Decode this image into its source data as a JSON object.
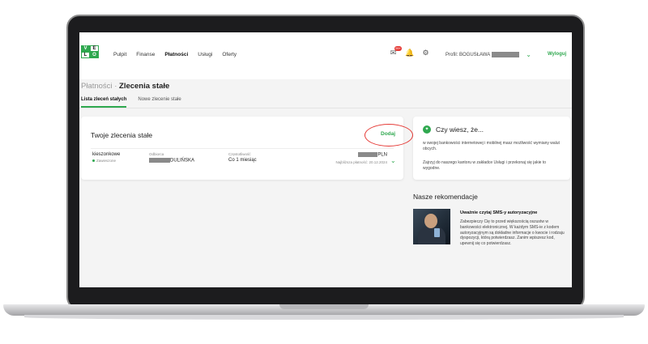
{
  "nav": {
    "items": [
      "Pulpit",
      "Finanse",
      "Płatności",
      "Usługi",
      "Oferty"
    ],
    "active": "Płatności"
  },
  "notifications": {
    "badge": "99+"
  },
  "profile": {
    "label": "Profil: BOGUSŁAWA"
  },
  "logout": "Wyloguj",
  "breadcrumb": {
    "parent": "Płatności",
    "separator": "·",
    "current": "Zlecenia stałe"
  },
  "tabs": [
    "Lista zleceń stałych",
    "Nowe zlecenie stałe"
  ],
  "orders": {
    "title": "Twoje zlecenia stałe",
    "add_label": "Dodaj",
    "row": {
      "name": "kieszonkowe",
      "status": "Zawieszone",
      "recipient_label": "Odbiorca",
      "recipient": "DULIŃSKA",
      "frequency_label": "Częstotliwość",
      "frequency": "Co 1 miesiąc",
      "amount": "PLN",
      "next_payment": "Najbliższa płatność: 20.12.2024"
    }
  },
  "tip": {
    "title": "Czy wiesz, że...",
    "p1": "w swojej bankowości internetowej i mobilnej masz możliwość wymiany walut obcych.",
    "p2": "Zajrzyj do naszego kantoru w zakładce Usługi i przekonaj się jakie to wygodne."
  },
  "recommendations": {
    "title": "Nasze rekomendacje",
    "item_title": "Uważnie czytaj SMS-y autoryzacyjne",
    "item_text": "Zabezpieczy Cię to przed większością oszustw w bankowości elektronicznej. W każdym SMS-ie z kodem autoryzacyjnym są dokładne informacje o kwocie i rodzaju dyspozycji, którą potwierdzasz. Zanim wpiszesz kod, upewnij się co potwierdzasz."
  },
  "colors": {
    "accent": "#2fa84f",
    "highlight": "#e53935"
  }
}
